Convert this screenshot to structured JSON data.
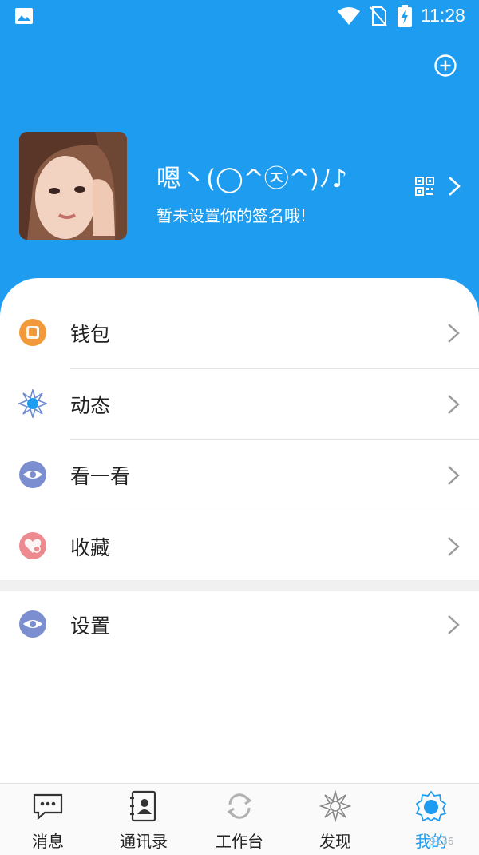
{
  "status_bar": {
    "time": "11:28",
    "icons": [
      "gallery-icon",
      "wifi-icon",
      "no-sim-icon",
      "battery-charging-icon"
    ]
  },
  "header": {
    "add_icon": "add-circle-icon",
    "nickname": "嗯丶(◯^㉨^)ﾉ♪",
    "signature": "暂未设置你的签名哦!",
    "qr_icon": "qr-code-icon",
    "chevron_icon": "chevron-right-icon"
  },
  "menu": {
    "items": [
      {
        "label": "钱包",
        "icon": "wallet-icon"
      },
      {
        "label": "动态",
        "icon": "moments-icon"
      },
      {
        "label": "看一看",
        "icon": "eye-icon"
      },
      {
        "label": "收藏",
        "icon": "favorite-icon"
      }
    ],
    "settings": {
      "label": "设置",
      "icon": "settings-icon"
    }
  },
  "tabbar": {
    "tabs": [
      {
        "label": "消息",
        "icon": "chat-bubble-icon"
      },
      {
        "label": "通讯录",
        "icon": "contacts-book-icon"
      },
      {
        "label": "工作台",
        "icon": "sync-icon"
      },
      {
        "label": "发现",
        "icon": "discover-icon"
      },
      {
        "label": "我的",
        "icon": "profile-gear-icon",
        "active": true
      }
    ]
  },
  "watermark": "9136",
  "colors": {
    "primary": "#1e9df0",
    "wallet": "#f29a3b",
    "eye": "#7b8fd0",
    "favorite": "#ec8a8f"
  }
}
